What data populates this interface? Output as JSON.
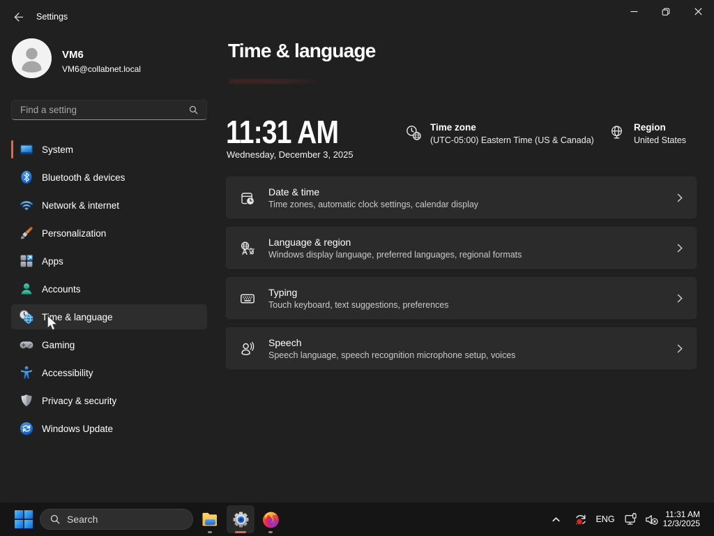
{
  "window": {
    "title": "Settings"
  },
  "sidebar": {
    "user": {
      "name": "VM6",
      "email": "VM6@collabnet.local"
    },
    "search_placeholder": "Find a setting",
    "items": [
      {
        "key": "system",
        "label": "System",
        "selected": false,
        "indicator": true
      },
      {
        "key": "bluetooth",
        "label": "Bluetooth & devices",
        "selected": false,
        "indicator": false
      },
      {
        "key": "network",
        "label": "Network & internet",
        "selected": false,
        "indicator": false
      },
      {
        "key": "personalization",
        "label": "Personalization",
        "selected": false,
        "indicator": false
      },
      {
        "key": "apps",
        "label": "Apps",
        "selected": false,
        "indicator": false
      },
      {
        "key": "accounts",
        "label": "Accounts",
        "selected": false,
        "indicator": false
      },
      {
        "key": "time-language",
        "label": "Time & language",
        "selected": true,
        "indicator": false
      },
      {
        "key": "gaming",
        "label": "Gaming",
        "selected": false,
        "indicator": false
      },
      {
        "key": "accessibility",
        "label": "Accessibility",
        "selected": false,
        "indicator": false
      },
      {
        "key": "privacy",
        "label": "Privacy & security",
        "selected": false,
        "indicator": false
      },
      {
        "key": "windows-update",
        "label": "Windows Update",
        "selected": false,
        "indicator": false
      }
    ]
  },
  "main": {
    "title": "Time & language",
    "clock": {
      "time": "11:31 AM",
      "date": "Wednesday, December 3, 2025"
    },
    "timezone": {
      "label": "Time zone",
      "value": "(UTC-05:00) Eastern Time (US & Canada)"
    },
    "region": {
      "label": "Region",
      "value": "United States"
    },
    "cards": [
      {
        "key": "date-time",
        "title": "Date & time",
        "desc": "Time zones, automatic clock settings, calendar display"
      },
      {
        "key": "language-region",
        "title": "Language & region",
        "desc": "Windows display language, preferred languages, regional formats"
      },
      {
        "key": "typing",
        "title": "Typing",
        "desc": "Touch keyboard, text suggestions, preferences"
      },
      {
        "key": "speech",
        "title": "Speech",
        "desc": "Speech language, speech recognition microphone setup, voices"
      }
    ]
  },
  "taskbar": {
    "search_label": "Search",
    "apps": [
      "file-explorer",
      "settings",
      "firefox"
    ],
    "tray": {
      "language": "ENG",
      "time": "11:31 AM",
      "date": "12/3/2025"
    }
  },
  "colors": {
    "accent": "#d0704e",
    "app_bg": "#202020",
    "card_bg": "#2b2b2b",
    "taskbar_bg": "#151515"
  }
}
